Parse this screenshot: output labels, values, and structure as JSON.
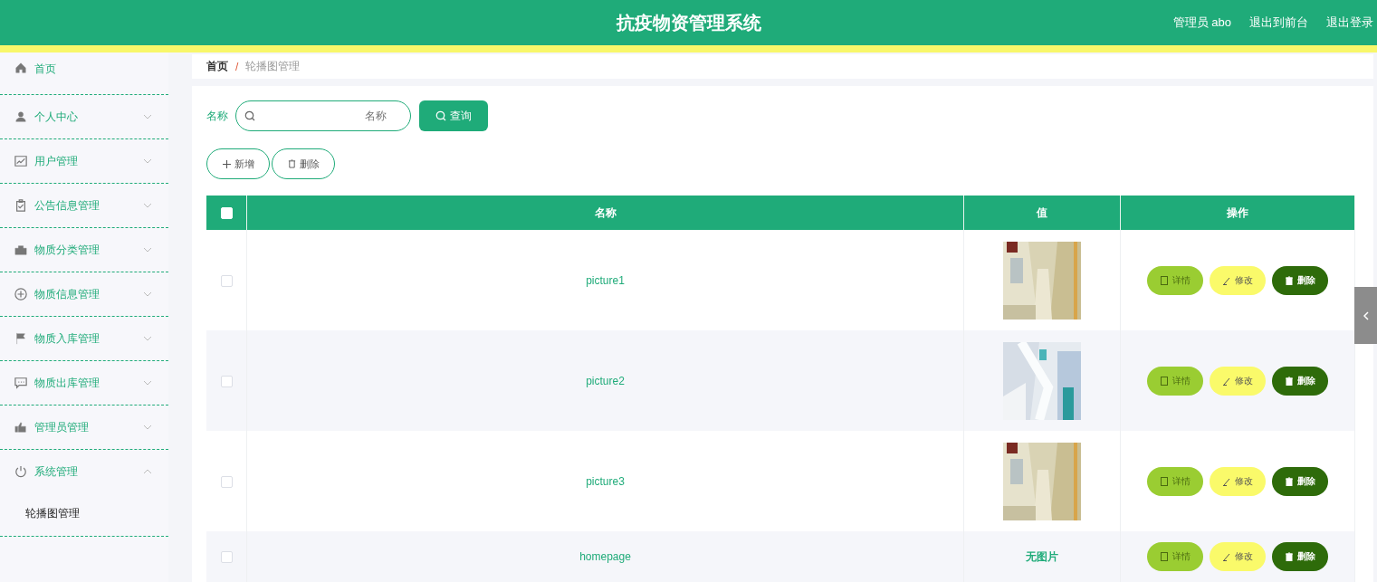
{
  "header": {
    "title": "抗疫物资管理系统",
    "links": [
      "管理员 abo",
      "退出到前台",
      "退出登录"
    ]
  },
  "sidebar": {
    "items": [
      {
        "label": "首页"
      },
      {
        "label": "个人中心",
        "expanded": false
      },
      {
        "label": "用户管理",
        "expanded": false
      },
      {
        "label": "公告信息管理",
        "expanded": false
      },
      {
        "label": "物质分类管理",
        "expanded": false
      },
      {
        "label": "物质信息管理",
        "expanded": false
      },
      {
        "label": "物质入库管理",
        "expanded": false
      },
      {
        "label": "物质出库管理",
        "expanded": false
      },
      {
        "label": "管理员管理",
        "expanded": false
      },
      {
        "label": "系统管理",
        "expanded": true,
        "children": [
          {
            "label": "轮播图管理"
          }
        ]
      }
    ]
  },
  "breadcrumb": [
    "首页",
    "/",
    "轮播图管理"
  ],
  "search": {
    "label": "名称",
    "placeholder": "名称",
    "button": "查询"
  },
  "actions": [
    {
      "label": "新增"
    },
    {
      "label": "删除"
    }
  ],
  "table": {
    "columns": [
      "名称",
      "值",
      "操作"
    ],
    "header_checked": false,
    "rows": [
      {
        "checked": false,
        "name": "picture1",
        "value": {
          "kind": "picture"
        },
        "buttons": [
          "详情",
          "修改",
          "删除"
        ]
      },
      {
        "checked": false,
        "name": "picture2",
        "value": {
          "kind": "picture"
        },
        "buttons": [
          "详情",
          "修改",
          "删除"
        ]
      },
      {
        "checked": false,
        "name": "picture3",
        "value": {
          "kind": "picture"
        },
        "buttons": [
          "详情",
          "修改",
          "删除"
        ]
      },
      {
        "checked": false,
        "name": "homepage",
        "value": {
          "kind": "text",
          "text": "无图片"
        },
        "buttons": [
          "详情",
          "修改",
          "删除"
        ]
      }
    ]
  }
}
